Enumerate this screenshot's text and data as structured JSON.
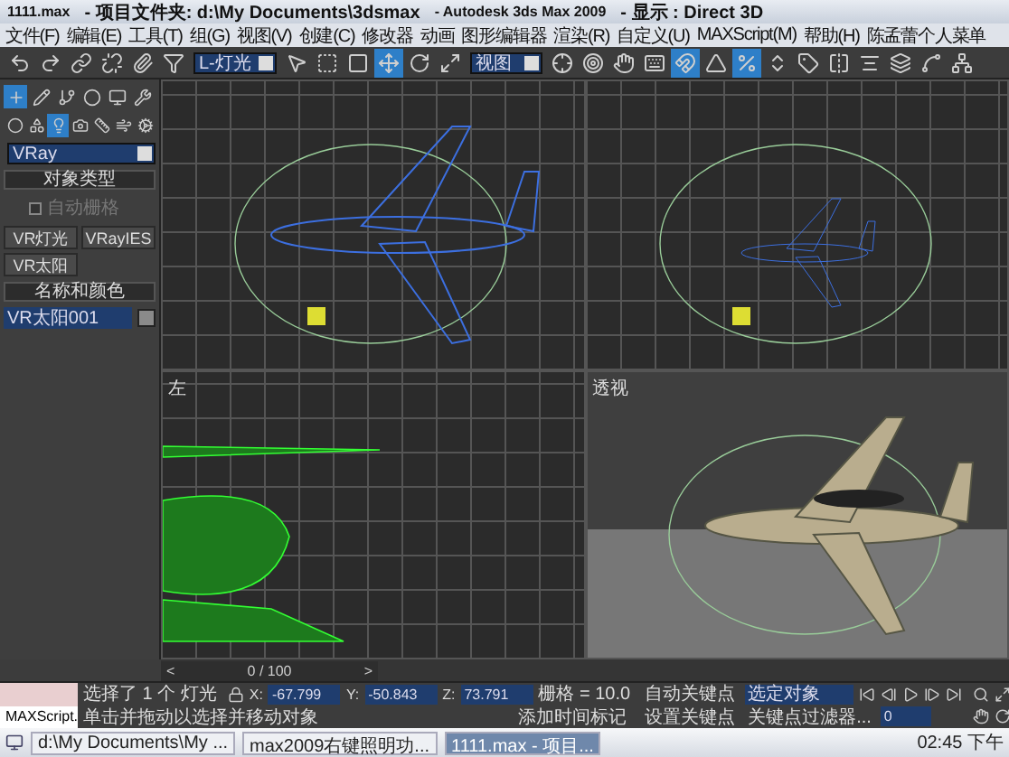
{
  "window": {
    "title_parts": [
      "1111.max",
      "- 项目文件夹: d:\\My Documents\\3dsmax",
      "- Autodesk 3ds Max  2009",
      "- 显示 : Direct 3D"
    ]
  },
  "menu": [
    "文件(F)",
    "编辑(E)",
    "工具(T)",
    "组(G)",
    "视图(V)",
    "创建(C)",
    "修改器",
    "动画",
    "图形编辑器",
    "渲染(R)",
    "自定义(U)",
    "MAXScript(M)",
    "帮助(H)",
    "陈孟蕾个人菜单"
  ],
  "toolbar": {
    "selection_filter": "L-灯光",
    "reference_coord": "视图",
    "tools": [
      {
        "kind": "undo",
        "selected": false
      },
      {
        "kind": "redo",
        "selected": false
      },
      {
        "kind": "link",
        "selected": false
      },
      {
        "kind": "unlink",
        "selected": false
      },
      {
        "kind": "bind",
        "selected": false
      },
      {
        "kind": "filter",
        "selected": false
      },
      {
        "kind": "pointer",
        "selected": false
      },
      {
        "kind": "region",
        "selected": false
      },
      {
        "kind": "window",
        "selected": false
      },
      {
        "kind": "move",
        "selected": true
      },
      {
        "kind": "rotate",
        "selected": false
      },
      {
        "kind": "scale",
        "selected": false
      },
      {
        "kind": "coord",
        "selected": false
      },
      {
        "kind": "pivot",
        "selected": false
      },
      {
        "kind": "manipulate",
        "selected": false
      },
      {
        "kind": "keyboard",
        "selected": false
      },
      {
        "kind": "snap",
        "selected": true
      },
      {
        "kind": "angle",
        "selected": false
      },
      {
        "kind": "percent",
        "selected": true
      },
      {
        "kind": "spinner",
        "selected": false
      },
      {
        "kind": "named",
        "selected": false
      },
      {
        "kind": "mirror",
        "selected": false
      },
      {
        "kind": "align",
        "selected": false
      },
      {
        "kind": "layers",
        "selected": false
      },
      {
        "kind": "curve",
        "selected": false
      },
      {
        "kind": "schematic",
        "selected": false
      }
    ]
  },
  "command_panel": {
    "tabs": [
      {
        "kind": "create",
        "selected": true
      },
      {
        "kind": "modify",
        "selected": false
      },
      {
        "kind": "hierarchy",
        "selected": false
      },
      {
        "kind": "motion",
        "selected": false
      },
      {
        "kind": "display",
        "selected": false
      },
      {
        "kind": "utilities",
        "selected": false
      }
    ],
    "categories": [
      {
        "kind": "geometry",
        "selected": false
      },
      {
        "kind": "shapes",
        "selected": false
      },
      {
        "kind": "lights",
        "selected": true
      },
      {
        "kind": "cameras",
        "selected": false
      },
      {
        "kind": "helpers",
        "selected": false
      },
      {
        "kind": "warps",
        "selected": false
      },
      {
        "kind": "systems",
        "selected": false
      }
    ],
    "type_dropdown": "VRay",
    "object_type_title": "对象类型",
    "auto_grid": {
      "label": "自动栅格",
      "checked": false
    },
    "object_buttons": [
      "VR灯光",
      "VRayIES",
      "VR太阳"
    ],
    "name_color_title": "名称和颜色",
    "name_field": "VR太阳001"
  },
  "viewports": [
    {
      "kind": "top"
    },
    {
      "kind": "front"
    },
    {
      "kind": "left",
      "label": "左"
    },
    {
      "kind": "perspective",
      "label": "透视"
    }
  ],
  "timeline": {
    "prev": "<",
    "frame": "0 / 100",
    "next": ">",
    "level": 0
  },
  "status": {
    "listener": "MAXScript.",
    "selection": "选择了 1 个 灯光",
    "prompt": "单击并拖动以选择并移动对象",
    "coords": [
      {
        "axis": "X:",
        "value": "-67.799"
      },
      {
        "axis": "Y:",
        "value": "-50.843"
      },
      {
        "axis": "Z:",
        "value": "73.791"
      }
    ],
    "grid": "栅格 = 10.0",
    "time_tag": "添加时间标记",
    "auto_key": "自动关键点",
    "key_set": "选定对象",
    "set_key": "设置关键点",
    "key_filters": "关键点过滤器...",
    "frame": "0"
  },
  "taskbar": {
    "tasks": [
      {
        "label": "d:\\My Documents\\My ...",
        "selected": false
      },
      {
        "label": "max2009右键照明功...",
        "selected": false
      },
      {
        "label": "1111.max - 项目...",
        "selected": true
      }
    ],
    "clock": "02:45 下午"
  }
}
